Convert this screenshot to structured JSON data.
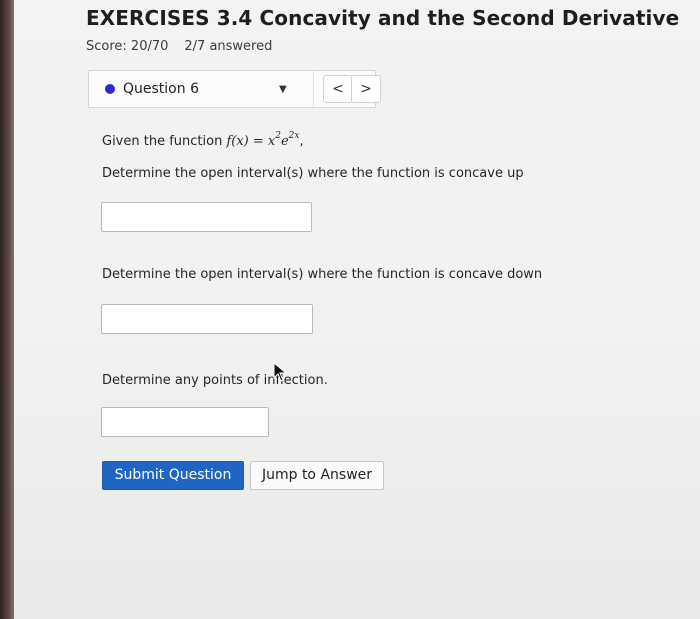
{
  "header": {
    "title": "EXERCISES 3.4 Concavity and the Second Derivative",
    "score": "Score: 20/70",
    "answered": "2/7 answered"
  },
  "question_nav": {
    "label": "Question 6",
    "prev_label": "<",
    "next_label": ">",
    "status_color": "#2b2bd0"
  },
  "question": {
    "given_prefix": "Given the function ",
    "function_lhs": "f(x) = x",
    "exp1": "2",
    "function_mid": "e",
    "exp2": "2x",
    "given_suffix": ",",
    "prompt_concave_up": "Determine the open interval(s) where the function is concave up",
    "prompt_concave_down": "Determine the open interval(s) where the function is concave down",
    "prompt_inflection": "Determine any points of inflection."
  },
  "answers": {
    "concave_up": "",
    "concave_down": "",
    "inflection": ""
  },
  "buttons": {
    "submit": "Submit Question",
    "jump": "Jump to Answer",
    "submit_color": "#1f66c4"
  },
  "icons": {
    "cursor": "mouse-pointer-icon",
    "dropdown": "caret-down-icon"
  }
}
